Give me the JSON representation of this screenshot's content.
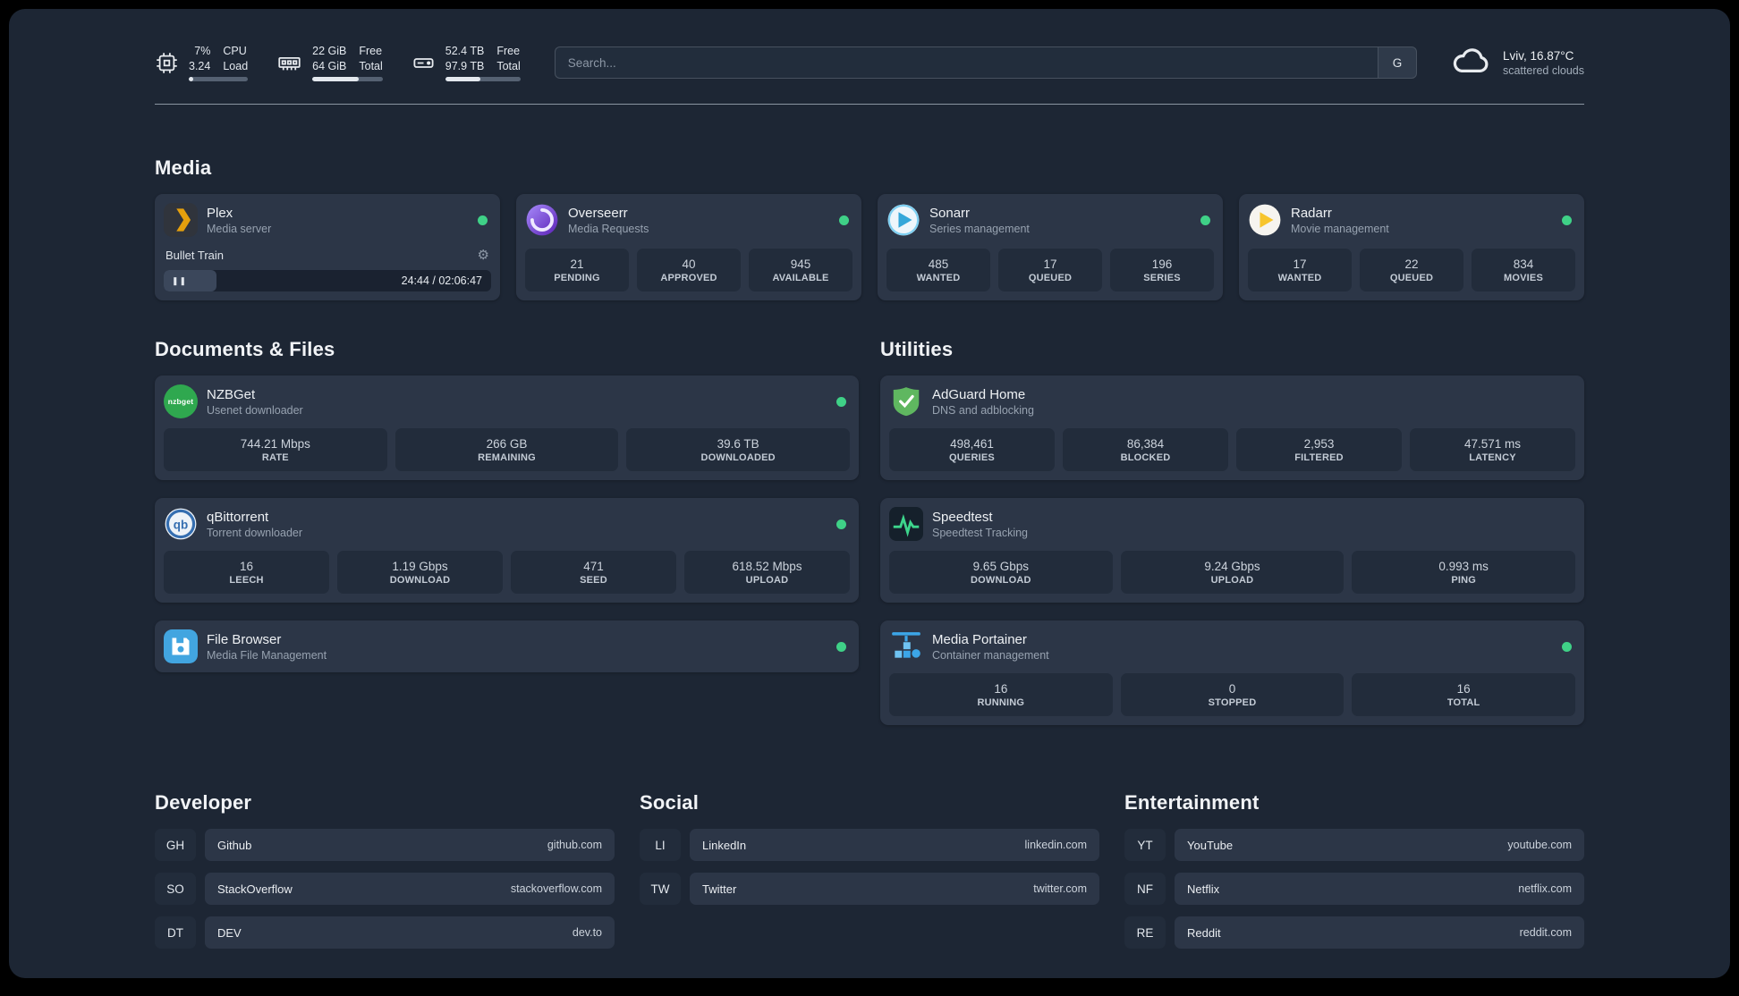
{
  "topbar": {
    "resources": [
      {
        "value_top": "7%",
        "value_bottom": "3.24",
        "label_top": "CPU",
        "label_bottom": "Load",
        "progress": 7
      },
      {
        "value_top": "22 GiB",
        "value_bottom": "64 GiB",
        "label_top": "Free",
        "label_bottom": "Total",
        "progress": 66
      },
      {
        "value_top": "52.4 TB",
        "value_bottom": "97.9 TB",
        "label_top": "Free",
        "label_bottom": "Total",
        "progress": 47
      }
    ],
    "search": {
      "placeholder": "Search...",
      "provider": "G"
    },
    "weather": {
      "location": "Lviv, 16.87°C",
      "condition": "scattered clouds"
    }
  },
  "groups": {
    "media": {
      "title": "Media",
      "plex": {
        "name": "Plex",
        "desc": "Media server",
        "now_playing": "Bullet Train",
        "time": "24:44 / 02:06:47",
        "progress": 16
      },
      "overseerr": {
        "name": "Overseerr",
        "desc": "Media Requests",
        "stats": [
          {
            "v": "21",
            "l": "PENDING"
          },
          {
            "v": "40",
            "l": "APPROVED"
          },
          {
            "v": "945",
            "l": "AVAILABLE"
          }
        ]
      },
      "sonarr": {
        "name": "Sonarr",
        "desc": "Series management",
        "stats": [
          {
            "v": "485",
            "l": "WANTED"
          },
          {
            "v": "17",
            "l": "QUEUED"
          },
          {
            "v": "196",
            "l": "SERIES"
          }
        ]
      },
      "radarr": {
        "name": "Radarr",
        "desc": "Movie management",
        "stats": [
          {
            "v": "17",
            "l": "WANTED"
          },
          {
            "v": "22",
            "l": "QUEUED"
          },
          {
            "v": "834",
            "l": "MOVIES"
          }
        ]
      }
    },
    "documents": {
      "title": "Documents & Files",
      "nzbget": {
        "name": "NZBGet",
        "desc": "Usenet downloader",
        "icon_text": "nzbget",
        "stats": [
          {
            "v": "744.21 Mbps",
            "l": "RATE"
          },
          {
            "v": "266 GB",
            "l": "REMAINING"
          },
          {
            "v": "39.6 TB",
            "l": "DOWNLOADED"
          }
        ]
      },
      "qbittorrent": {
        "name": "qBittorrent",
        "desc": "Torrent downloader",
        "stats": [
          {
            "v": "16",
            "l": "LEECH"
          },
          {
            "v": "1.19 Gbps",
            "l": "DOWNLOAD"
          },
          {
            "v": "471",
            "l": "SEED"
          },
          {
            "v": "618.52 Mbps",
            "l": "UPLOAD"
          }
        ]
      },
      "filebrowser": {
        "name": "File Browser",
        "desc": "Media File Management"
      }
    },
    "utilities": {
      "title": "Utilities",
      "adguard": {
        "name": "AdGuard Home",
        "desc": "DNS and adblocking",
        "stats": [
          {
            "v": "498,461",
            "l": "QUERIES"
          },
          {
            "v": "86,384",
            "l": "BLOCKED"
          },
          {
            "v": "2,953",
            "l": "FILTERED"
          },
          {
            "v": "47.571 ms",
            "l": "LATENCY"
          }
        ]
      },
      "speedtest": {
        "name": "Speedtest",
        "desc": "Speedtest Tracking",
        "stats": [
          {
            "v": "9.65 Gbps",
            "l": "DOWNLOAD"
          },
          {
            "v": "9.24 Gbps",
            "l": "UPLOAD"
          },
          {
            "v": "0.993 ms",
            "l": "PING"
          }
        ]
      },
      "portainer": {
        "name": "Media Portainer",
        "desc": "Container management",
        "stats": [
          {
            "v": "16",
            "l": "RUNNING"
          },
          {
            "v": "0",
            "l": "STOPPED"
          },
          {
            "v": "16",
            "l": "TOTAL"
          }
        ]
      }
    }
  },
  "bookmarks": {
    "developer": {
      "title": "Developer",
      "items": [
        {
          "abbr": "GH",
          "name": "Github",
          "url": "github.com"
        },
        {
          "abbr": "SO",
          "name": "StackOverflow",
          "url": "stackoverflow.com"
        },
        {
          "abbr": "DT",
          "name": "DEV",
          "url": "dev.to"
        }
      ]
    },
    "social": {
      "title": "Social",
      "items": [
        {
          "abbr": "LI",
          "name": "LinkedIn",
          "url": "linkedin.com"
        },
        {
          "abbr": "TW",
          "name": "Twitter",
          "url": "twitter.com"
        }
      ]
    },
    "entertainment": {
      "title": "Entertainment",
      "items": [
        {
          "abbr": "YT",
          "name": "YouTube",
          "url": "youtube.com"
        },
        {
          "abbr": "NF",
          "name": "Netflix",
          "url": "netflix.com"
        },
        {
          "abbr": "RE",
          "name": "Reddit",
          "url": "reddit.com"
        }
      ]
    }
  }
}
